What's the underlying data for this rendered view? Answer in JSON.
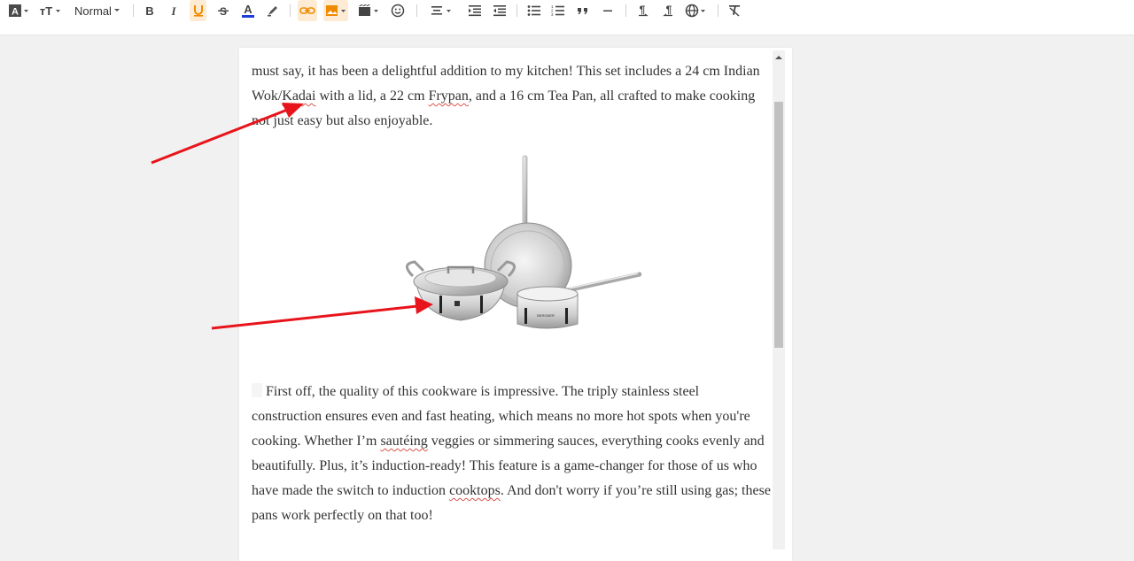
{
  "toolbar": {
    "style_select": "Normal",
    "icons": [
      "font-family-icon",
      "font-size-icon",
      "bold-icon",
      "italic-icon",
      "underline-icon",
      "strikethrough-icon",
      "font-color-icon",
      "highlight-icon",
      "link-icon",
      "image-icon",
      "video-icon",
      "emoji-icon",
      "align-icon",
      "indent-icon",
      "outdent-icon",
      "bullet-list-icon",
      "numbered-list-icon",
      "blockquote-icon",
      "horizontal-rule-icon",
      "ltr-icon",
      "rtl-icon",
      "language-icon",
      "clear-format-icon"
    ]
  },
  "content": {
    "para1": {
      "t1": "must say, it has been a delightful addition to my kitchen! This set includes a 24 cm Indian Wok/",
      "w1": "Kadai",
      "t2": " with a lid, a 22 cm ",
      "w2": "Frypan",
      "t3": ", and a 16 cm Tea Pan, all crafted to make cooking not just easy but also enjoyable."
    },
    "image": {
      "brand_text": "BERGNER"
    },
    "para2": {
      "t1": "First off, the quality of this cookware is impressive. The triply stainless steel construction ensures even and fast heating, which means no more hot spots when you're cooking. Whether I’m ",
      "w1": "sautéing",
      "t2": " veggies or simmering sauces, everything cooks evenly and beautifully. Plus, it’s induction-ready! This feature is a game-changer for those of us who have made the switch to induction ",
      "w2": "cooktops",
      "t3": ". And don't worry if you’re still using gas; these pans work perfectly on that too!"
    }
  },
  "colors": {
    "accent_orange": "#f08a00",
    "annotation_arrow": "#e8141b",
    "spell_underline": "#d9534f",
    "text": "#333333"
  }
}
